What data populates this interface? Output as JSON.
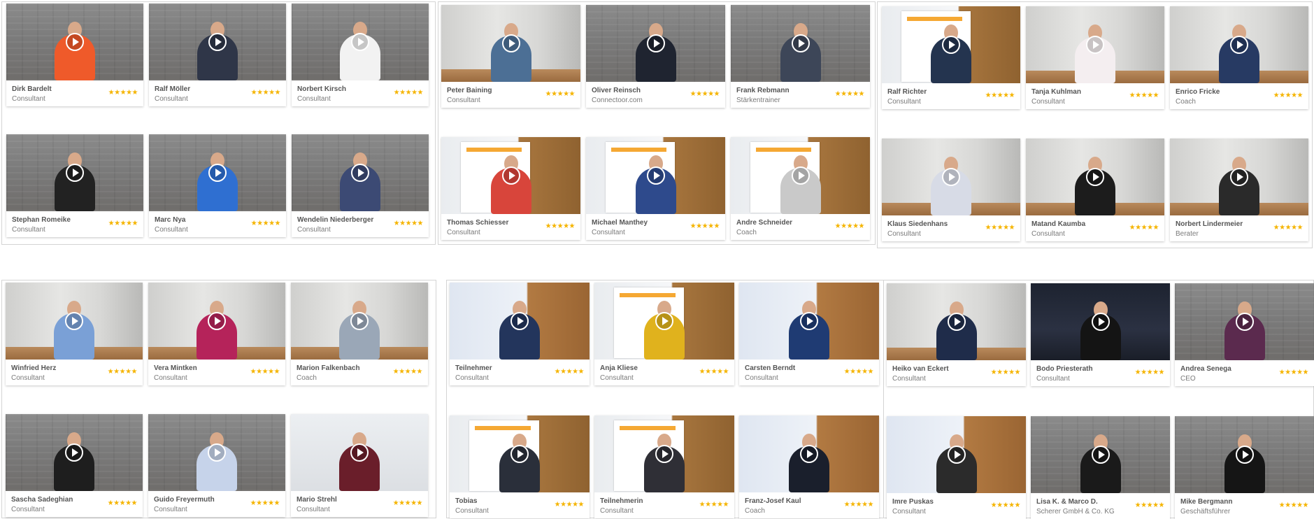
{
  "panels": [
    {
      "cards": [
        {
          "name": "Dirk Bardelt",
          "role": "Consultant",
          "stars": "★★★★★",
          "bg": "brick",
          "shirt": "#ef5a2a"
        },
        {
          "name": "Ralf Möller",
          "role": "Consultant",
          "stars": "★★★★★",
          "bg": "brick",
          "shirt": "#2f3648"
        },
        {
          "name": "Norbert Kirsch",
          "role": "Consultant",
          "stars": "★★★★★",
          "bg": "brick",
          "shirt": "#f2f2f2"
        },
        {
          "name": "Stephan Romeike",
          "role": "Consultant",
          "stars": "★★★★★",
          "bg": "brick",
          "shirt": "#222222"
        },
        {
          "name": "Marc Nya",
          "role": "Consultant",
          "stars": "★★★★★",
          "bg": "brick",
          "shirt": "#2f6fd1"
        },
        {
          "name": "Wendelin Niederberger",
          "role": "Consultant",
          "stars": "★★★★★",
          "bg": "brick",
          "shirt": "#3c4a74"
        }
      ]
    },
    {
      "cards": [
        {
          "name": "Peter Baining",
          "role": "Consultant",
          "stars": "★★★★★",
          "bg": "office",
          "shirt": "#4c6f95"
        },
        {
          "name": "Oliver Reinsch",
          "role": "Connectoor.com",
          "stars": "★★★★★",
          "bg": "brick",
          "shirt": "#1f2430"
        },
        {
          "name": "Frank Rebmann",
          "role": "Stärkentrainer",
          "stars": "★★★★★",
          "bg": "brick",
          "shirt": "#3d4658"
        },
        {
          "name": "Thomas Schiesser",
          "role": "Consultant",
          "stars": "★★★★★",
          "bg": "banner",
          "shirt": "#d8453b"
        },
        {
          "name": "Michael Manthey",
          "role": "Consultant",
          "stars": "★★★★★",
          "bg": "banner",
          "shirt": "#2e4a8c"
        },
        {
          "name": "Andre Schneider",
          "role": "Coach",
          "stars": "★★★★★",
          "bg": "banner",
          "shirt": "#c9c9c9"
        }
      ]
    },
    {
      "cards": [
        {
          "name": "Ralf Richter",
          "role": "Consultant",
          "stars": "★★★★★",
          "bg": "banner",
          "shirt": "#24344f"
        },
        {
          "name": "Tanja Kuhlman",
          "role": "Consultant",
          "stars": "★★★★★",
          "bg": "office",
          "shirt": "#f4eef0"
        },
        {
          "name": "Enrico Fricke",
          "role": "Coach",
          "stars": "★★★★★",
          "bg": "office",
          "shirt": "#273a63"
        },
        {
          "name": "Klaus Siedenhans",
          "role": "Consultant",
          "stars": "★★★★★",
          "bg": "office",
          "shirt": "#d7dbe6"
        },
        {
          "name": "Matand Kaumba",
          "role": "Consultant",
          "stars": "★★★★★",
          "bg": "office",
          "shirt": "#1c1c1c"
        },
        {
          "name": "Norbert Lindermeier",
          "role": "Berater",
          "stars": "★★★★★",
          "bg": "office",
          "shirt": "#2a2a2a"
        }
      ]
    },
    {
      "cards": [
        {
          "name": "Winfried Herz",
          "role": "Consultant",
          "stars": "★★★★★",
          "bg": "office",
          "shirt": "#7aa0d6"
        },
        {
          "name": "Vera Mintken",
          "role": "Consultant",
          "stars": "★★★★★",
          "bg": "office",
          "shirt": "#b5235a"
        },
        {
          "name": "Marion Falkenbach",
          "role": "Coach",
          "stars": "★★★★★",
          "bg": "office",
          "shirt": "#9aa7b7"
        },
        {
          "name": "Sascha Sadeghian",
          "role": "Consultant",
          "stars": "★★★★★",
          "bg": "brick",
          "shirt": "#1e1e1e"
        },
        {
          "name": "Guido Freyermuth",
          "role": "Consultant",
          "stars": "★★★★★",
          "bg": "brick",
          "shirt": "#c6d3ea"
        },
        {
          "name": "Mario Strehl",
          "role": "Consultant",
          "stars": "★★★★★",
          "bg": "bright",
          "shirt": "#6a1e2a"
        }
      ]
    },
    {
      "cards": [
        {
          "name": "Teilnehmer",
          "role": "Consultant",
          "stars": "★★★★★",
          "bg": "door",
          "shirt": "#23355c"
        },
        {
          "name": "Anja Kliese",
          "role": "Consultant",
          "stars": "★★★★★",
          "bg": "banner",
          "shirt": "#e0b21d"
        },
        {
          "name": "Carsten Berndt",
          "role": "Consultant",
          "stars": "★★★★★",
          "bg": "door",
          "shirt": "#1f3b73"
        },
        {
          "name": "Tobias",
          "role": "Consultant",
          "stars": "★★★★★",
          "bg": "banner",
          "shirt": "#2a2f3a"
        },
        {
          "name": "Teilnehmerin",
          "role": "Consultant",
          "stars": "★★★★★",
          "bg": "banner",
          "shirt": "#2f2f36"
        },
        {
          "name": "Franz-Josef Kaul",
          "role": "Coach",
          "stars": "★★★★★",
          "bg": "door",
          "shirt": "#1a1f2c"
        }
      ]
    },
    {
      "cards": [
        {
          "name": "Heiko van Eckert",
          "role": "Consultant",
          "stars": "★★★★★",
          "bg": "office",
          "shirt": "#1f2c4a"
        },
        {
          "name": "Bodo Priesterath",
          "role": "Consultant",
          "stars": "★★★★★",
          "bg": "dark",
          "shirt": "#141414"
        },
        {
          "name": "Andrea Senega",
          "role": "CEO",
          "stars": "★★★★★",
          "bg": "brick",
          "shirt": "#5b2a4e"
        },
        {
          "name": "Imre Puskas",
          "role": "Consultant",
          "stars": "★★★★★",
          "bg": "door",
          "shirt": "#2b2b2b"
        },
        {
          "name": "Lisa K. & Marco D.",
          "role": "Scherer GmbH & Co. KG",
          "stars": "★★★★★",
          "bg": "brick",
          "shirt": "#1a1a1a"
        },
        {
          "name": "Mike Bergmann",
          "role": "Geschäftsführer",
          "stars": "★★★★★",
          "bg": "brick",
          "shirt": "#151515"
        }
      ]
    }
  ]
}
